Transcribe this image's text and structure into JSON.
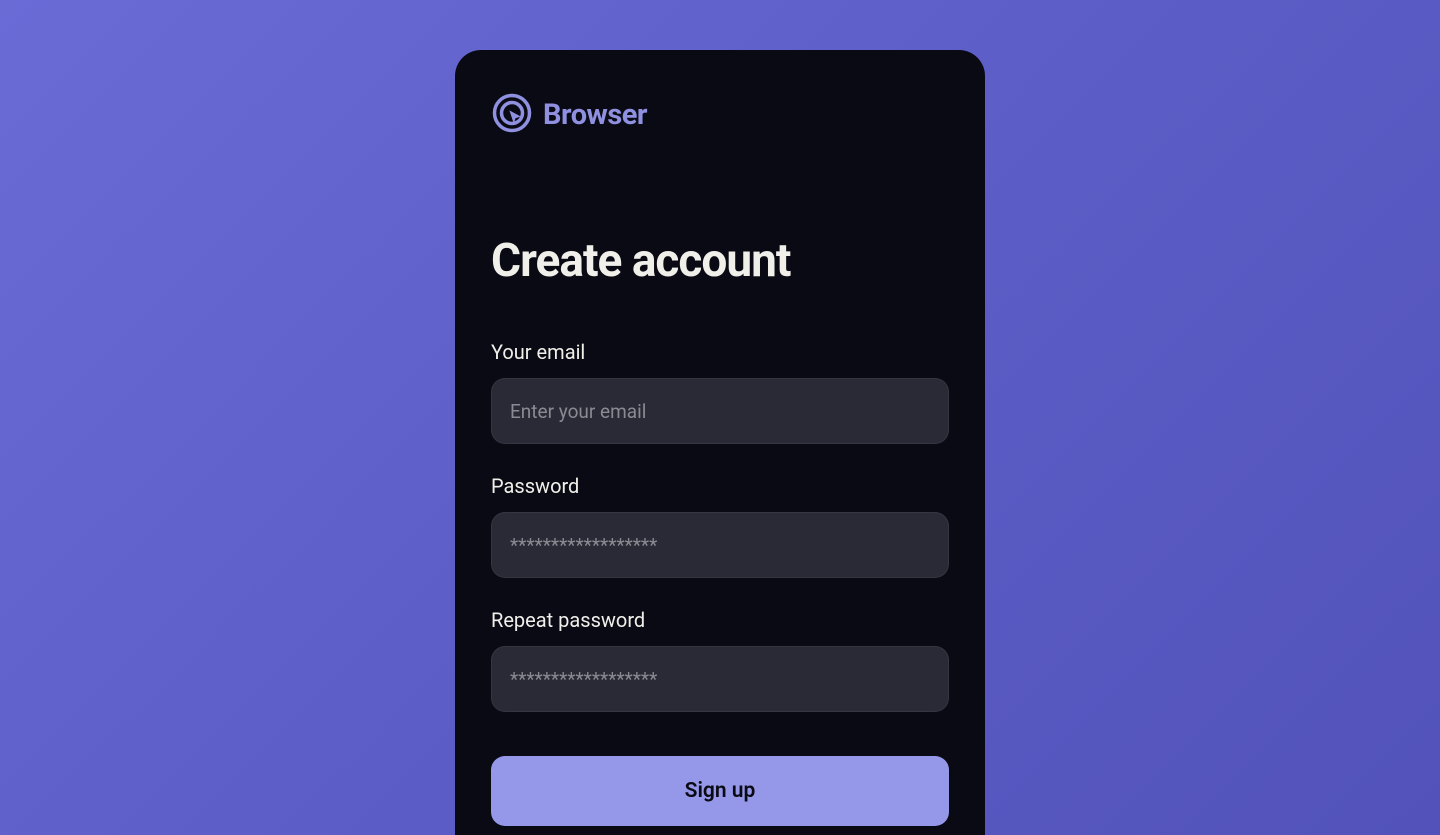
{
  "brand": {
    "name": "Browser",
    "iconName": "cursor-target-icon",
    "color": "#8f90e0"
  },
  "title": "Create account",
  "fields": {
    "email": {
      "label": "Your email",
      "placeholder": "Enter your email",
      "value": ""
    },
    "password": {
      "label": "Password",
      "placeholder": "******************",
      "value": ""
    },
    "repeatPassword": {
      "label": "Repeat password",
      "placeholder": "******************",
      "value": ""
    }
  },
  "actions": {
    "submitLabel": "Sign up"
  },
  "colors": {
    "accent": "#9598e8",
    "cardBackground": "#0a0a14",
    "inputBackground": "#2a2a36",
    "pageBackground": "#5d5dc7"
  }
}
